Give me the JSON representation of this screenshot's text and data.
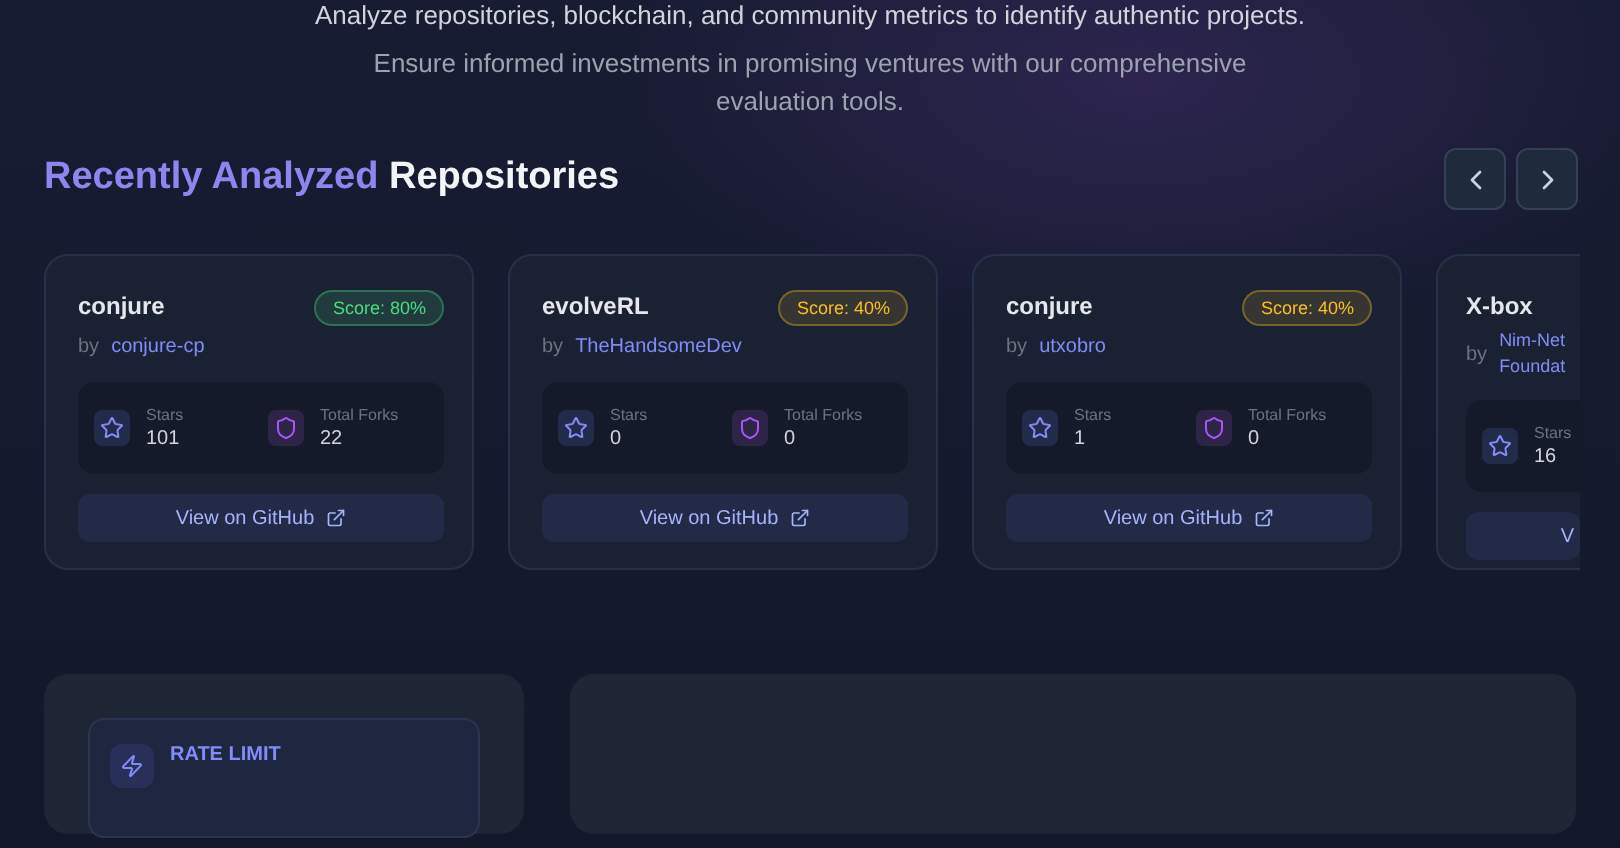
{
  "hero": {
    "lines": [
      "Analyze repositories, blockchain, and community metrics to identify authentic projects.",
      "Ensure informed investments in promising ventures with our comprehensive evaluation tools."
    ]
  },
  "section": {
    "title_accent": "Recently Analyzed",
    "title_rest": "Repositories"
  },
  "repositories": [
    {
      "name": "conjure",
      "by": "by",
      "author": "conjure-cp",
      "score": "Score: 80%",
      "color": "#4ade80",
      "stars_label": "Stars",
      "stars": "101",
      "forks_label": "Total Forks",
      "forks": "22",
      "button": "View on GitHub"
    },
    {
      "name": "evolveRL",
      "by": "by",
      "author": "TheHandsomeDev",
      "score": "Score: 40%",
      "color": "#fbbf24",
      "stars_label": "Stars",
      "stars": "0",
      "forks_label": "Total Forks",
      "forks": "0",
      "button": "View on GitHub"
    },
    {
      "name": "conjure",
      "by": "by",
      "author": "utxobro",
      "score": "Score: 40%",
      "color": "#fbbf24",
      "stars_label": "Stars",
      "stars": "1",
      "forks_label": "Total Forks",
      "forks": "0",
      "button": "View on GitHub"
    },
    {
      "name": "X-box",
      "by": "by",
      "author": "Nim-Net Foundat",
      "stars_label": "Stars",
      "stars": "16",
      "button": "V"
    }
  ],
  "panel": {
    "heading": "RATE LIMIT"
  }
}
